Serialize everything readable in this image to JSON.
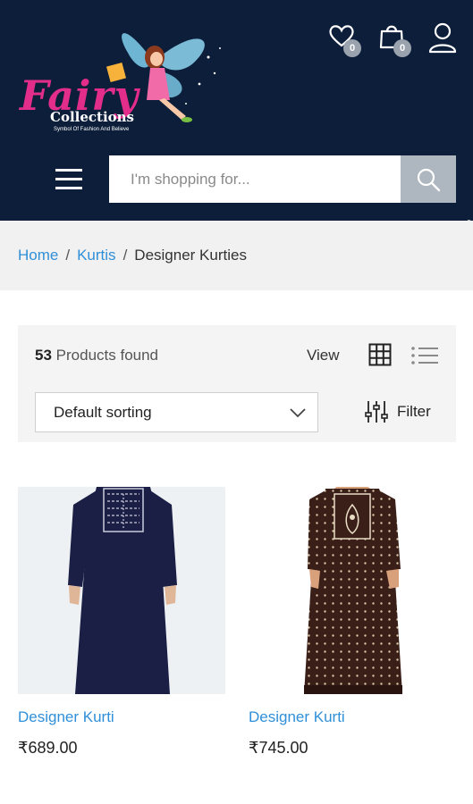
{
  "header": {
    "logo": {
      "brand": "Fairy",
      "sub": "Collections",
      "tagline": "Symbol Of Fashion And Believe"
    },
    "wishlist_count": "0",
    "cart_count": "0",
    "search_placeholder": "I'm shopping for...",
    "icons": [
      "heart-icon",
      "shopping-bag-icon",
      "user-icon",
      "hamburger-menu-icon",
      "search-icon"
    ]
  },
  "breadcrumb": {
    "home": "Home",
    "category": "Kurtis",
    "separator": "/",
    "current": "Designer Kurties"
  },
  "toolbar": {
    "count": "53",
    "count_label": "Products found",
    "view_label": "View",
    "sort_value": "Default sorting",
    "filter_label": "Filter"
  },
  "products": [
    {
      "name": "Designer Kurti",
      "price": "₹689.00"
    },
    {
      "name": "Designer Kurti",
      "price": "₹745.00"
    }
  ],
  "colors": {
    "header_bg": "#0c1e3a",
    "accent_pink": "#e22d8b",
    "link_blue": "#2f8fd8",
    "badge_gray": "#9aa3ad",
    "search_btn": "#aeb7bf"
  }
}
